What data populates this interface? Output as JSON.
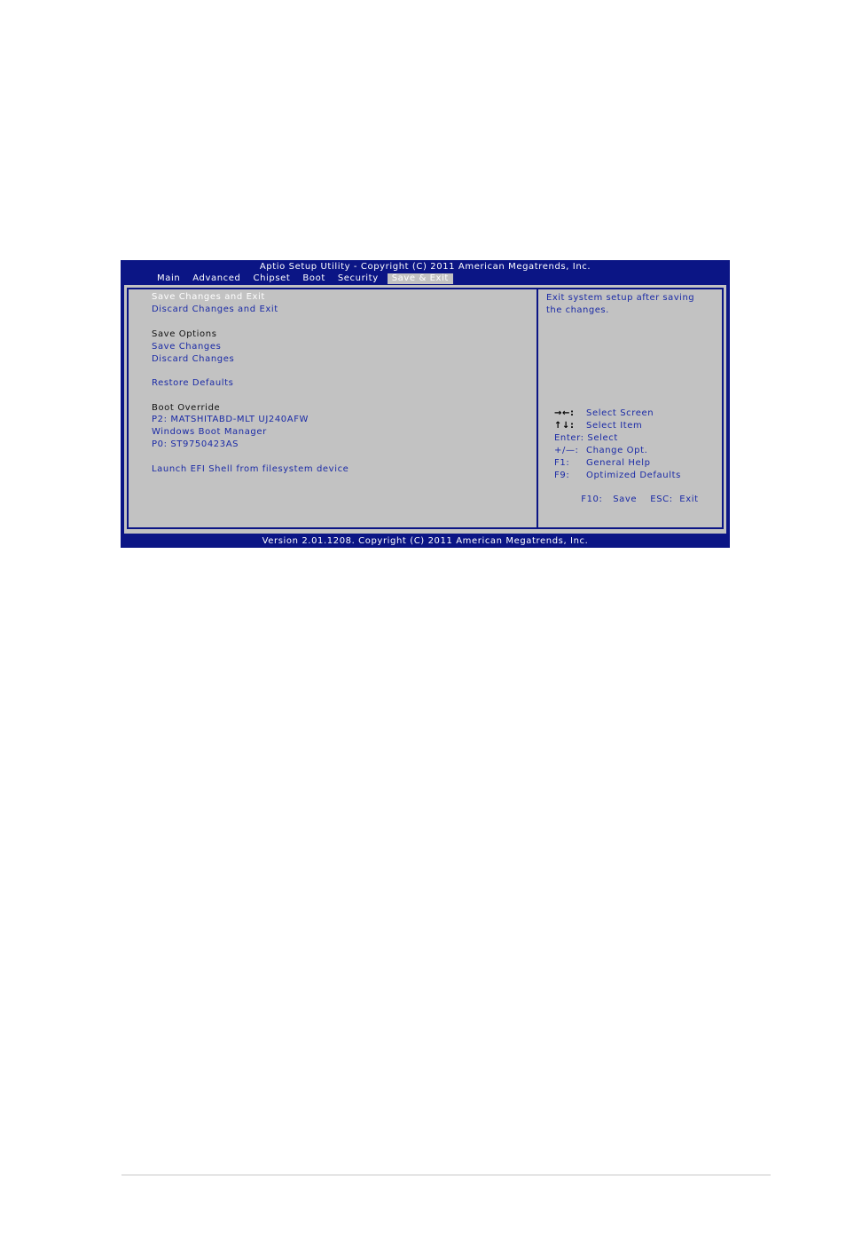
{
  "header": {
    "title": "Aptio Setup Utility - Copyright (C) 2011 American Megatrends, Inc."
  },
  "tabs": [
    {
      "label": "Main"
    },
    {
      "label": "Advanced"
    },
    {
      "label": "Chipset"
    },
    {
      "label": "Boot"
    },
    {
      "label": "Security"
    },
    {
      "label": "Save & Exit",
      "active": true
    }
  ],
  "menu": {
    "save_changes_and_exit": "Save Changes and Exit",
    "discard_changes_and_exit": "Discard Changes and Exit",
    "save_options_heading": "Save Options",
    "save_changes": "Save Changes",
    "discard_changes": "Discard Changes",
    "restore_defaults": "Restore Defaults",
    "boot_override_heading": "Boot Override",
    "boot_p2": "P2:  MATSHITABD-MLT UJ240AFW",
    "windows_boot_manager": "Windows Boot Manager",
    "boot_p0": "P0:  ST9750423AS",
    "launch_efi_shell": "Launch EFI Shell from filesystem device"
  },
  "help": {
    "line1": "Exit system setup after saving",
    "line2": "the changes."
  },
  "keys": [
    {
      "key": "→←:",
      "action": "Select Screen"
    },
    {
      "key": "↑↓:",
      "action": "Select Item"
    },
    {
      "key": "Enter:",
      "action": "Select"
    },
    {
      "key": "+/—:",
      "action": "Change Opt."
    },
    {
      "key": "F1:",
      "action": "General Help"
    },
    {
      "key": "F9:",
      "action": "Optimized Defaults"
    },
    {
      "key": "F10:",
      "action": "Save    ESC:  Exit"
    }
  ],
  "footer": {
    "version": "Version 2.01.1208. Copyright (C) 2011 American Megatrends, Inc."
  },
  "colors": {
    "bios_blue": "#0b1585",
    "panel_gray": "#c2c2c2",
    "link_blue": "#1a2aa6"
  }
}
